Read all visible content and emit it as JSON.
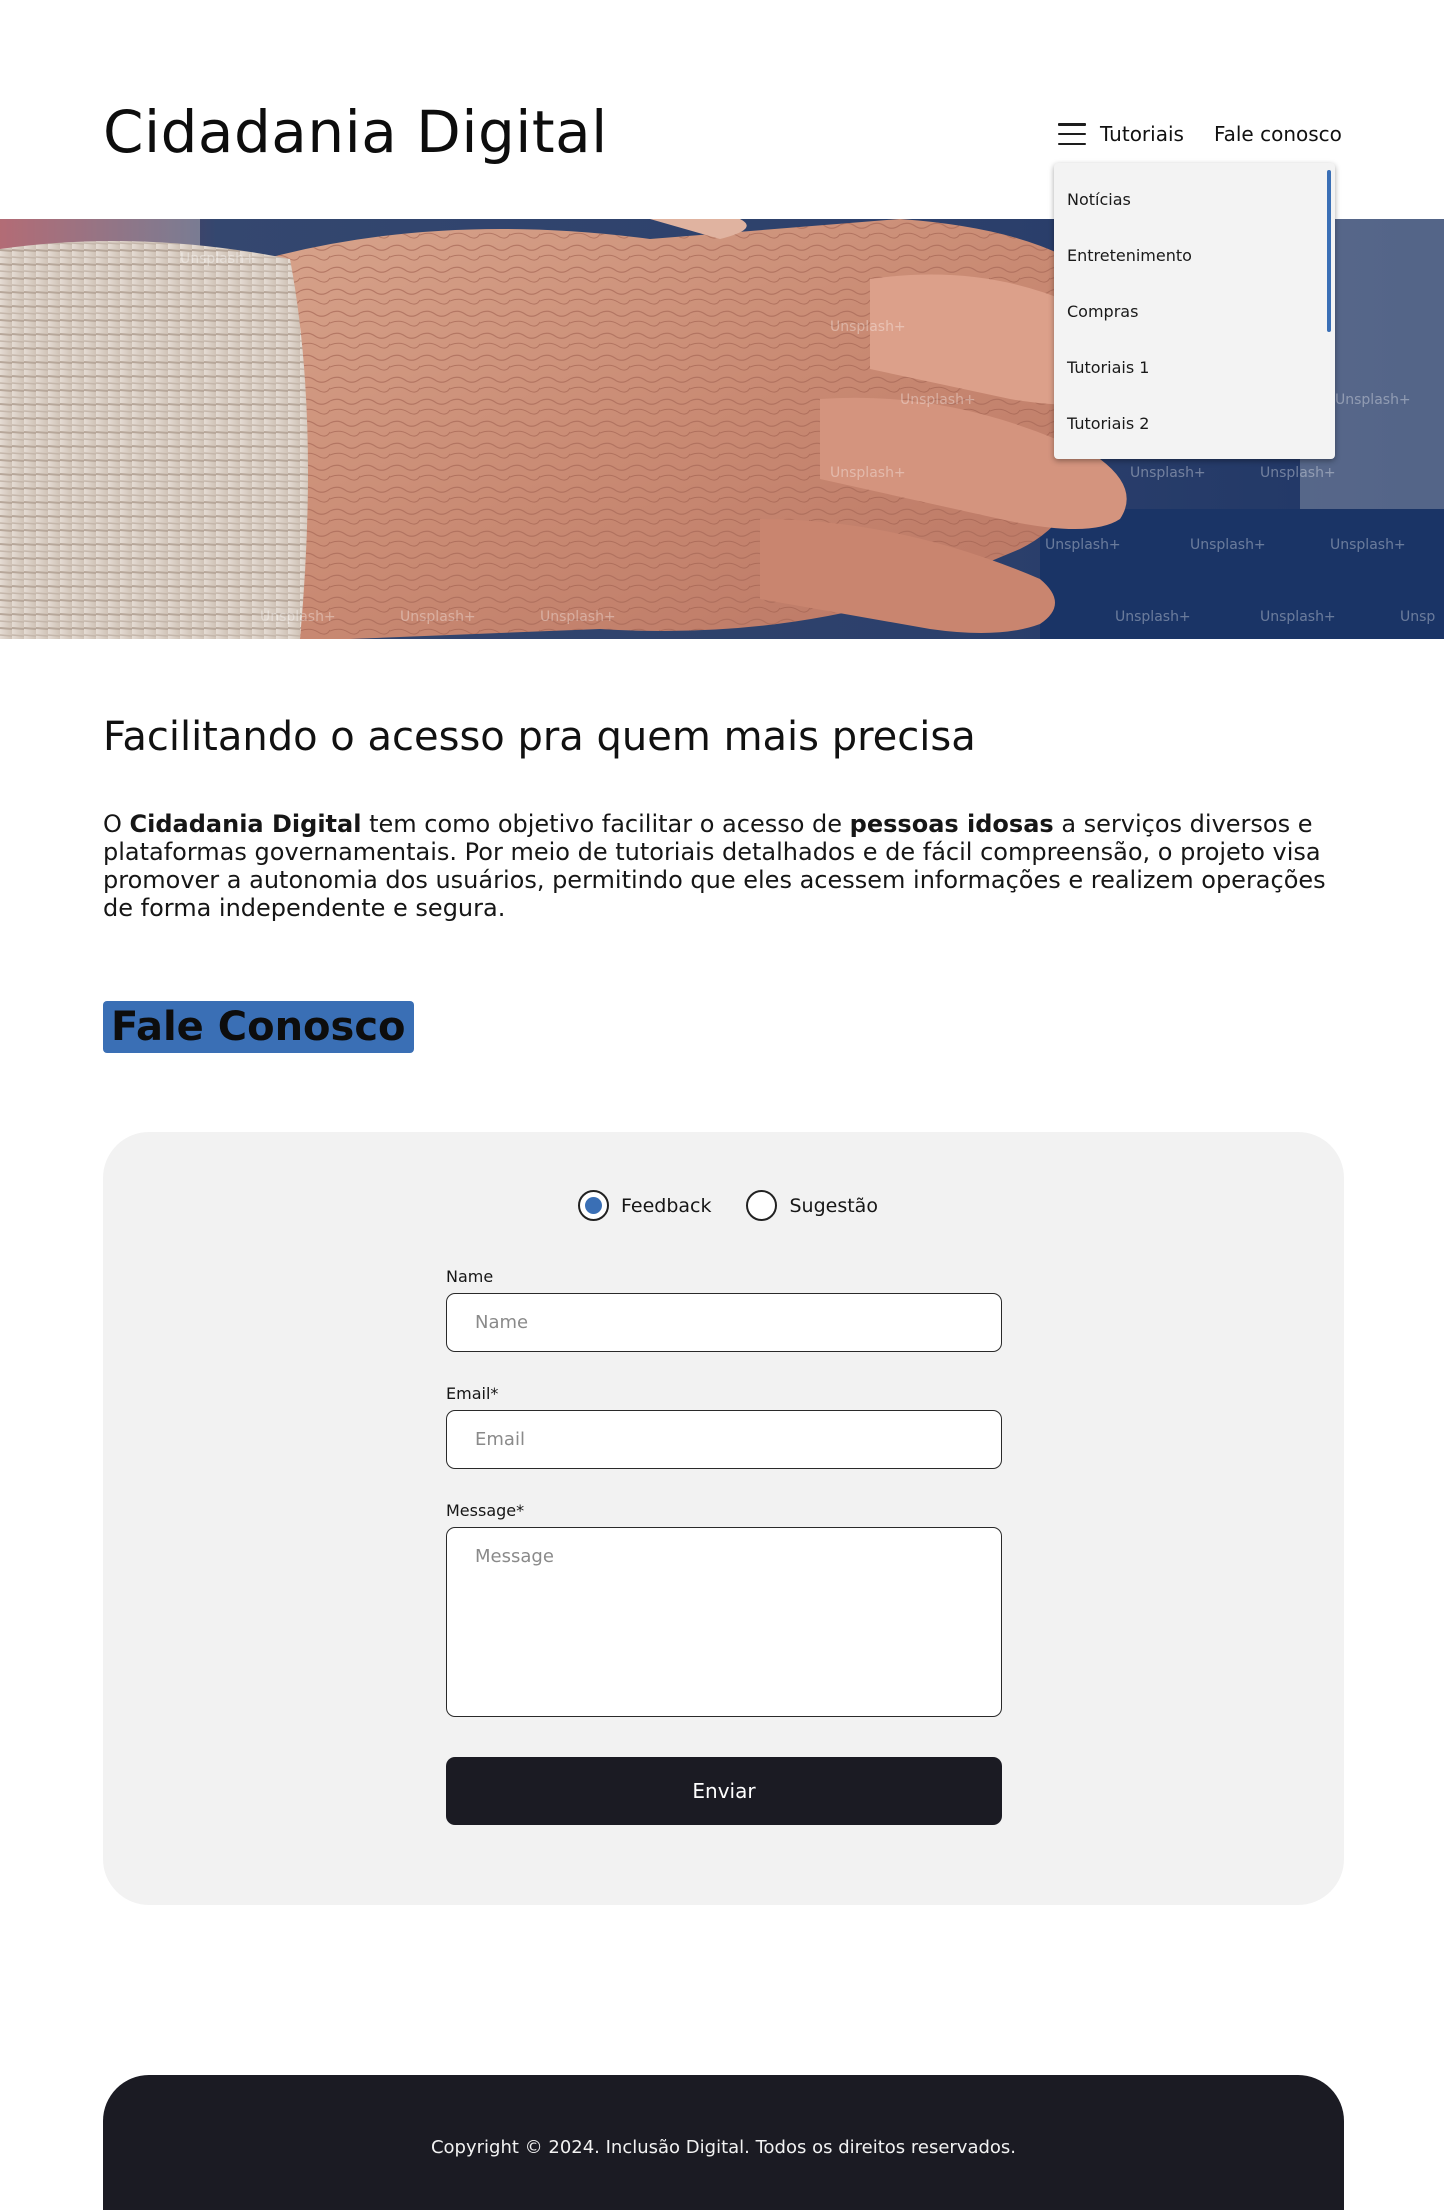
{
  "site": {
    "title": "Cidadania Digital"
  },
  "nav": {
    "menu_icon": "hamburger-icon",
    "tutoriais_label": "Tutoriais",
    "contact_label": "Fale conosco"
  },
  "dropdown": {
    "items": [
      {
        "label": "Notícias"
      },
      {
        "label": "Entretenimento"
      },
      {
        "label": "Compras"
      },
      {
        "label": "Tutoriais 1"
      },
      {
        "label": "Tutoriais 2"
      }
    ]
  },
  "hero": {
    "watermark": "Unsplash+"
  },
  "main": {
    "headline": "Facilitando o acesso pra quem mais precisa",
    "intro": {
      "part1": "O ",
      "bold1": "Cidadania Digital",
      "part2": " tem como objetivo facilitar o acesso de ",
      "bold2": "pessoas idosas",
      "part3": " a serviços diversos e plataformas governamentais. Por meio de tutoriais detalhados e de fácil compreensão, o projeto visa promover a autonomia dos usuários, permitindo que eles acessem informações e realizem operações de forma independente e segura."
    }
  },
  "contact": {
    "title": "Fale Conosco",
    "options": [
      {
        "label": "Feedback",
        "checked": true
      },
      {
        "label": "Sugestão",
        "checked": false
      }
    ],
    "name_label": "Name",
    "name_placeholder": "Name",
    "email_label": "Email*",
    "email_placeholder": "Email",
    "message_label": "Message*",
    "message_placeholder": "Message",
    "submit_label": "Enviar"
  },
  "footer": {
    "copyright": "Copyright © 2024. Inclusão Digital.  Todos os direitos reservados."
  },
  "colors": {
    "accent": "#3a6fb5",
    "dark": "#1b1b23",
    "card": "#f2f2f2",
    "dropdown": "#f3f3f3"
  }
}
